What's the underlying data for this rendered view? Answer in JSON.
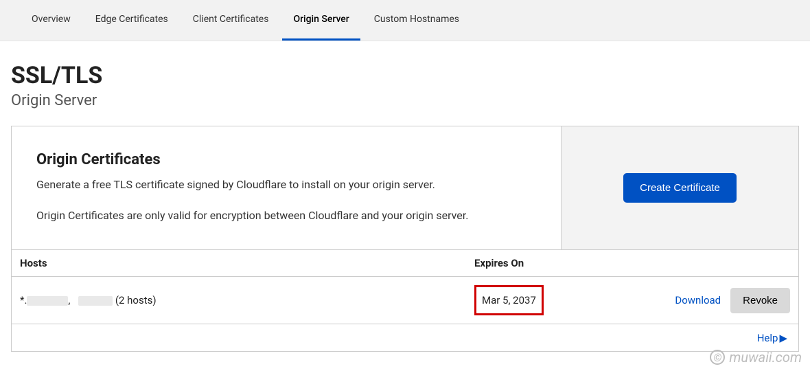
{
  "tabs": {
    "items": [
      {
        "label": "Overview"
      },
      {
        "label": "Edge Certificates"
      },
      {
        "label": "Client Certificates"
      },
      {
        "label": "Origin Server"
      },
      {
        "label": "Custom Hostnames"
      }
    ],
    "activeIndex": 3
  },
  "header": {
    "title": "SSL/TLS",
    "subtitle": "Origin Server"
  },
  "card": {
    "title": "Origin Certificates",
    "desc1": "Generate a free TLS certificate signed by Cloudflare to install on your origin server.",
    "desc2": "Origin Certificates are only valid for encryption between Cloudflare and your origin server.",
    "createBtn": "Create Certificate"
  },
  "table": {
    "headers": {
      "hosts": "Hosts",
      "expires": "Expires On"
    },
    "row": {
      "star": "*.",
      "comma": ",",
      "hostsSuffix": "(2 hosts)",
      "expires": "Mar 5, 2037",
      "download": "Download",
      "revoke": "Revoke"
    }
  },
  "footer": {
    "help": "Help"
  },
  "watermark": {
    "c": "©",
    "text": "muwaii.com"
  }
}
